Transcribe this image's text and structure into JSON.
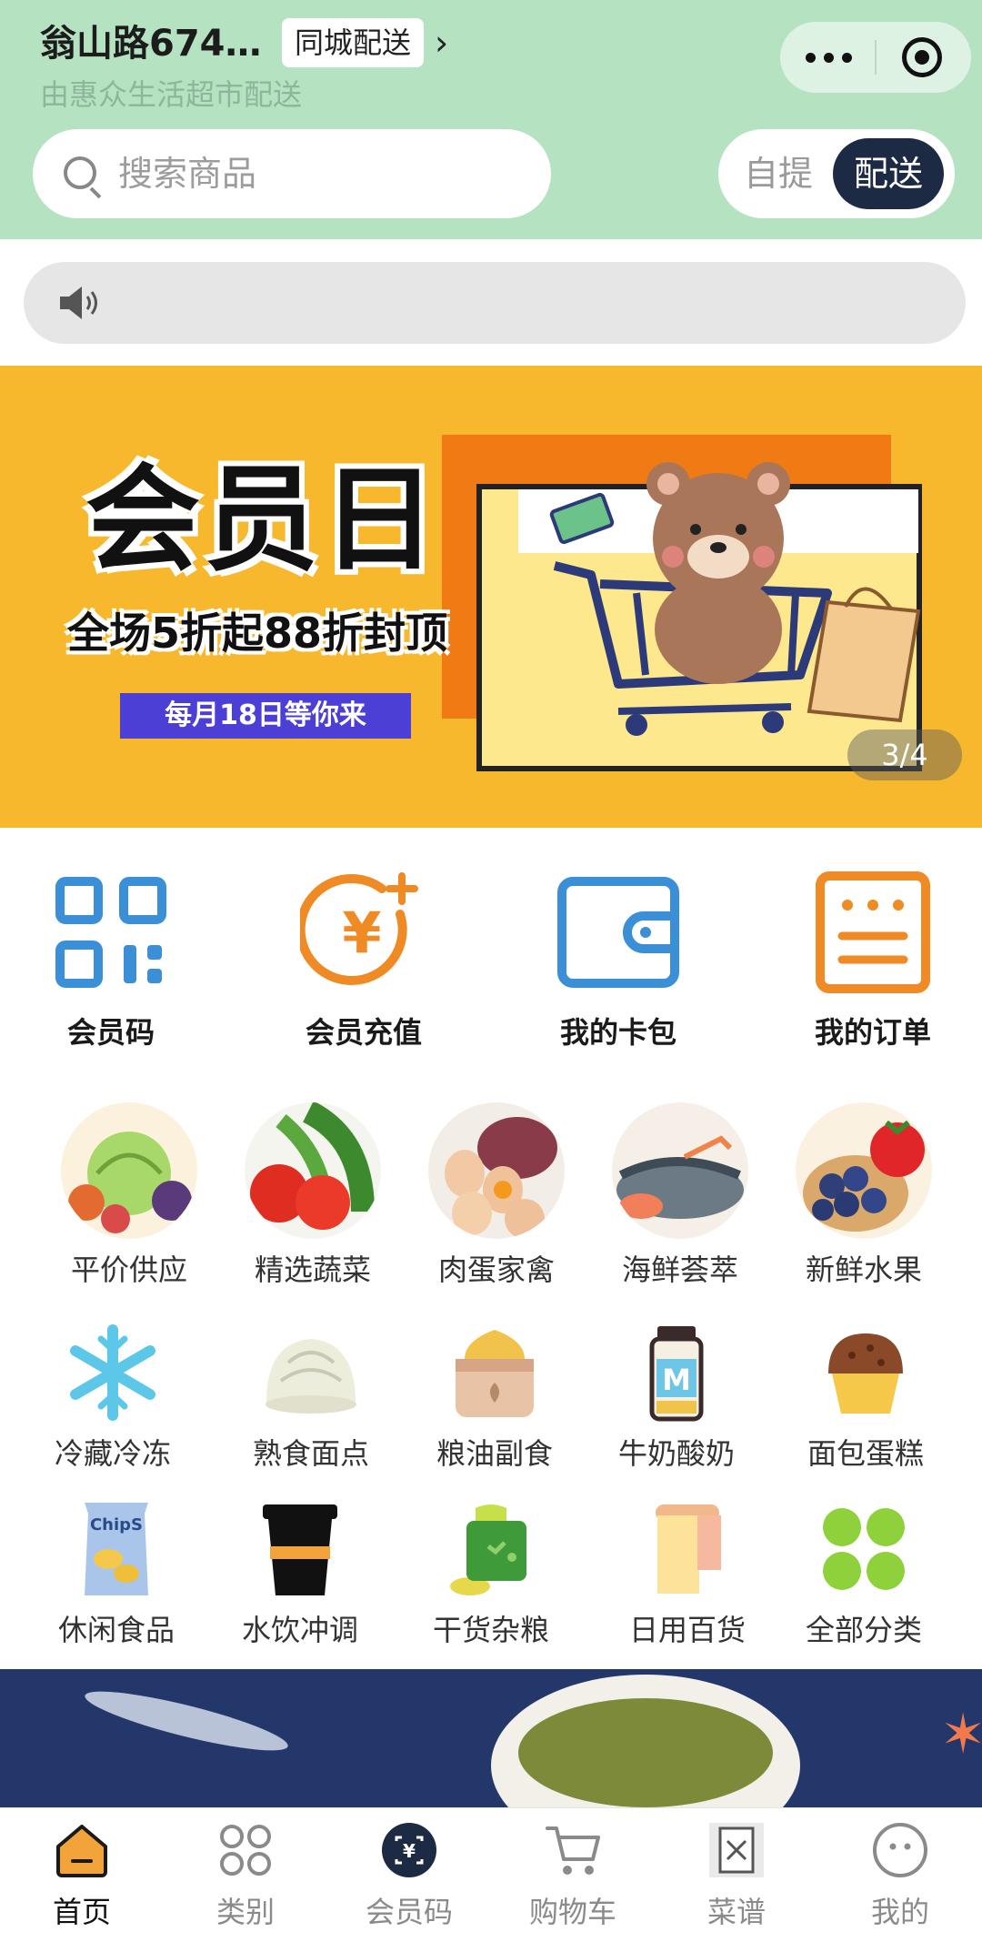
{
  "header": {
    "address": "翁山路674…",
    "delivery_tag": "同城配送",
    "sub_text": "由惠众生活超市配送",
    "search_placeholder": "搜索商品",
    "pickup_label": "自提",
    "delivery_label": "配送"
  },
  "banner": {
    "title": "会员日",
    "subtitle": "全场5折起88折封顶",
    "pill": "每月18日等你来",
    "pager": "3/4"
  },
  "quick_actions": [
    {
      "label": "会员码",
      "icon": "qr-code-icon"
    },
    {
      "label": "会员充值",
      "icon": "yuan-recharge-icon"
    },
    {
      "label": "我的卡包",
      "icon": "wallet-icon"
    },
    {
      "label": "我的订单",
      "icon": "order-list-icon"
    }
  ],
  "categories": [
    {
      "label": "平价供应",
      "icon": "vegetables-image"
    },
    {
      "label": "精选蔬菜",
      "icon": "tomato-greens-image"
    },
    {
      "label": "肉蛋家禽",
      "icon": "eggs-meat-image"
    },
    {
      "label": "海鲜荟萃",
      "icon": "seafood-image"
    },
    {
      "label": "新鲜水果",
      "icon": "berries-image"
    },
    {
      "label": "冷藏冷冻",
      "icon": "snowflake-icon"
    },
    {
      "label": "熟食面点",
      "icon": "bun-icon"
    },
    {
      "label": "粮油副食",
      "icon": "grain-sack-icon"
    },
    {
      "label": "牛奶酸奶",
      "icon": "milk-bottle-icon"
    },
    {
      "label": "面包蛋糕",
      "icon": "cupcake-icon"
    },
    {
      "label": "休闲食品",
      "icon": "chips-icon"
    },
    {
      "label": "水饮冲调",
      "icon": "cup-icon"
    },
    {
      "label": "干货杂粮",
      "icon": "dry-goods-icon"
    },
    {
      "label": "日用百货",
      "icon": "towel-icon"
    },
    {
      "label": "全部分类",
      "icon": "clover-icon"
    }
  ],
  "tabbar": [
    {
      "label": "首页",
      "icon": "home-icon",
      "active": true
    },
    {
      "label": "类别",
      "icon": "category-icon",
      "active": false
    },
    {
      "label": "会员码",
      "icon": "member-code-icon",
      "active": false
    },
    {
      "label": "购物车",
      "icon": "cart-icon",
      "active": false
    },
    {
      "label": "菜谱",
      "icon": "recipe-icon",
      "active": false
    },
    {
      "label": "我的",
      "icon": "profile-icon",
      "active": false
    }
  ],
  "colors": {
    "header_bg": "#b5e3c1",
    "accent_orange": "#f08a24",
    "accent_blue": "#3b8fd6",
    "dark_navy": "#1d2a44",
    "banner_yellow": "#f7b82e"
  }
}
